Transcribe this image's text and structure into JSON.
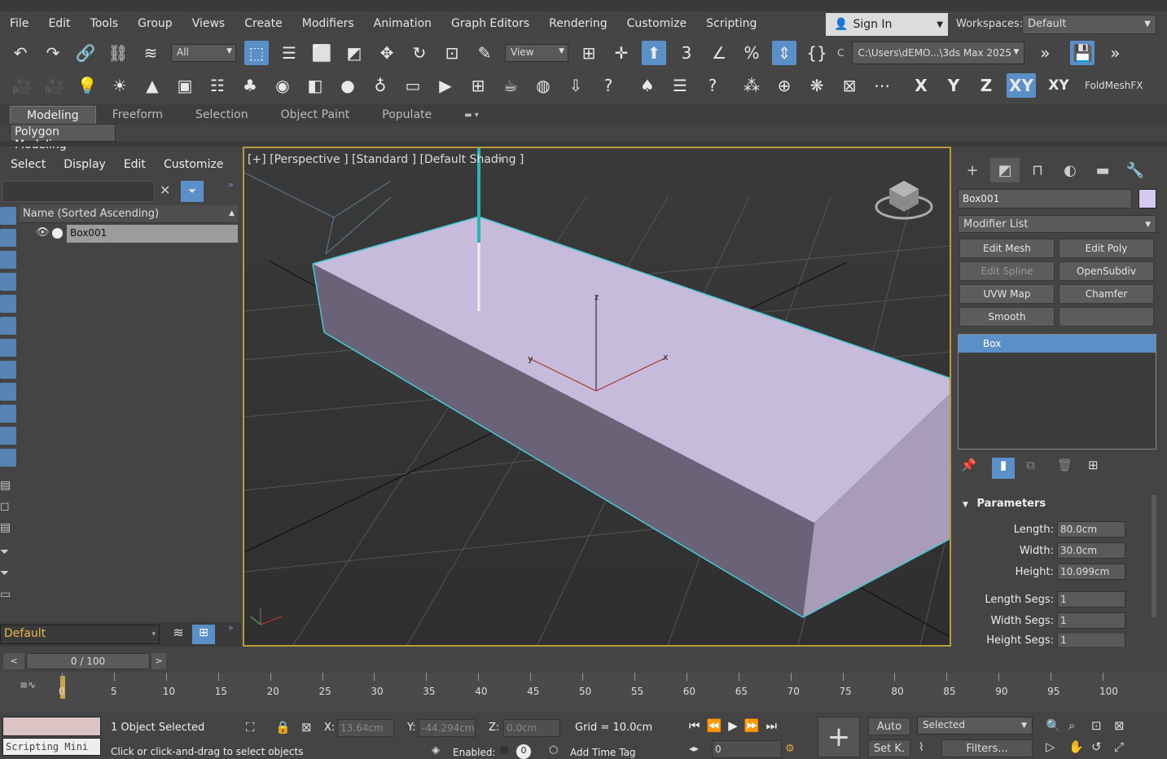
{
  "menu": [
    "File",
    "Edit",
    "Tools",
    "Group",
    "Views",
    "Create",
    "Modifiers",
    "Animation",
    "Graph Editors",
    "Rendering",
    "Customize",
    "Scripting"
  ],
  "signin": "Sign In",
  "workspace": {
    "label": "Workspaces:",
    "value": "Default"
  },
  "toolbar": {
    "selection_filter": "All",
    "ref_coord": "View",
    "project_path": "C:\\Users\\dEMO...\\3ds Max 2025",
    "small_c": "C",
    "plugin": "FoldMeshFX"
  },
  "axis_constraints": [
    "X",
    "Y",
    "Z",
    "XY",
    "XY"
  ],
  "ribbon": {
    "tabs": [
      "Modeling",
      "Freeform",
      "Selection",
      "Object Paint",
      "Populate"
    ],
    "active": "Modeling",
    "subtab": "Polygon Modeling"
  },
  "scene": {
    "menu": [
      "Select",
      "Display",
      "Edit",
      "Customize"
    ],
    "column": "Name (Sorted Ascending)",
    "objects": [
      "Box001"
    ],
    "layer": "Default"
  },
  "viewport": {
    "label": "[+] [Perspective ] [Standard ] [Default Shading ]",
    "gizmo_z": "z",
    "gizmo_x": "x",
    "gizmo_y": "y"
  },
  "command_panel": {
    "object_name": "Box001",
    "object_color": "#d6c8ee",
    "modifier_list": "Modifier List",
    "modifier_buttons": [
      "Edit Mesh",
      "Edit Poly",
      "Edit Spline",
      "OpenSubdiv",
      "UVW Map",
      "Chamfer",
      "Smooth",
      ""
    ],
    "stack": [
      "Box"
    ],
    "params_title": "Parameters",
    "params": [
      {
        "label": "Length:",
        "value": "80.0cm"
      },
      {
        "label": "Width:",
        "value": "30.0cm"
      },
      {
        "label": "Height:",
        "value": "10.099cm"
      },
      {
        "label": "Length Segs:",
        "value": "1"
      },
      {
        "label": "Width Segs:",
        "value": "1"
      },
      {
        "label": "Height Segs:",
        "value": "1"
      }
    ]
  },
  "timeline": {
    "slider": "0 / 100",
    "ticks": [
      "0",
      "5",
      "10",
      "15",
      "20",
      "25",
      "30",
      "35",
      "40",
      "45",
      "50",
      "55",
      "60",
      "65",
      "70",
      "75",
      "80",
      "85",
      "90",
      "95",
      "100"
    ]
  },
  "status": {
    "mini_label": "Scripting Mini",
    "selected": "1 Object Selected",
    "hint": "Click or click-and-drag to select objects",
    "x_label": "X:",
    "x": "13.64cm",
    "y_label": "Y:",
    "y": "-44.294cm",
    "z_label": "Z:",
    "z": "0.0cm",
    "grid": "Grid = 10.0cm",
    "enabled": "Enabled:",
    "enabled_value": "0",
    "add_time_tag": "Add Time Tag",
    "auto": "Auto",
    "set_key": "Set K.",
    "key_filter": "Selected",
    "filters": "Filters...",
    "frame": "0"
  },
  "colors": {
    "accent": "#5b8fc7",
    "box_top": "#c8bcdc",
    "box_side": "#8e839f",
    "selection_edge": "#47c8d6",
    "viewport_border": "#b89c3c"
  }
}
